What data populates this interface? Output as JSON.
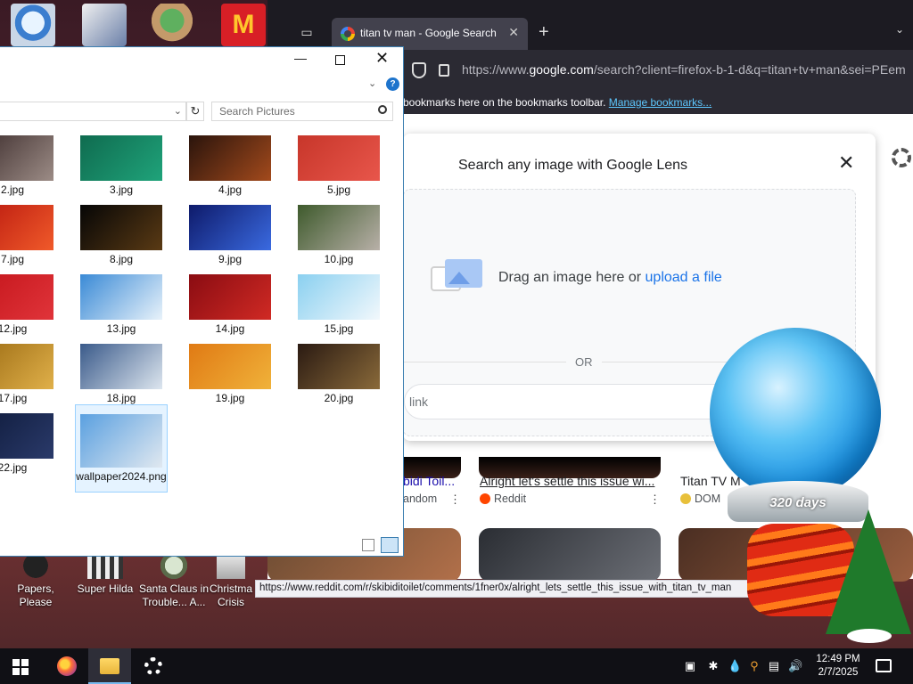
{
  "browser": {
    "tab_title": "titan tv man - Google Search",
    "url_prefix": "https://www.",
    "url_host": "google.com",
    "url_rest": "/search?client=firefox-b-1-d&q=titan+tv+man&sei=PEem",
    "bookmarks_text": "bookmarks here on the bookmarks toolbar. ",
    "bookmarks_link": "Manage bookmarks...",
    "lens": {
      "title": "Search any image with Google Lens",
      "drag_text": "Drag an image here or ",
      "upload_link": "upload a file",
      "or_text": "OR",
      "link_placeholder": "link"
    },
    "results": [
      {
        "title": "bidi Toil...",
        "source": "andom"
      },
      {
        "title": "Alright let's settle this issue wi...",
        "source": "Reddit"
      },
      {
        "title": "Titan TV M",
        "source": "DOM"
      }
    ],
    "status_url": "https://www.reddit.com/r/skibiditoilet/comments/1fner0x/alright_lets_settle_this_issue_with_titan_tv_man"
  },
  "explorer": {
    "search_placeholder": "Search Pictures",
    "files": [
      {
        "name": "2.jpg",
        "colors": [
          "#3a2a2a",
          "#9c8c86"
        ]
      },
      {
        "name": "3.jpg",
        "colors": [
          "#0f6b4f",
          "#1fa37a"
        ]
      },
      {
        "name": "4.jpg",
        "colors": [
          "#2a140c",
          "#a34a1c"
        ]
      },
      {
        "name": "5.jpg",
        "colors": [
          "#c7362a",
          "#e8564b"
        ]
      },
      {
        "name": "7.jpg",
        "colors": [
          "#b7160e",
          "#f05a2a"
        ]
      },
      {
        "name": "8.jpg",
        "colors": [
          "#060606",
          "#5a3a14"
        ]
      },
      {
        "name": "9.jpg",
        "colors": [
          "#0e1a6a",
          "#3a6ae0"
        ]
      },
      {
        "name": "10.jpg",
        "colors": [
          "#3e5a2c",
          "#b8b0a8"
        ]
      },
      {
        "name": "12.jpg",
        "colors": [
          "#c3141a",
          "#e0343a"
        ]
      },
      {
        "name": "13.jpg",
        "colors": [
          "#3a8ad6",
          "#e8f2fa"
        ]
      },
      {
        "name": "14.jpg",
        "colors": [
          "#8a0c12",
          "#d02a24"
        ]
      },
      {
        "name": "15.jpg",
        "colors": [
          "#8ad0f0",
          "#f2f8fc"
        ]
      },
      {
        "name": "17.jpg",
        "colors": [
          "#9a6a12",
          "#e0b04a"
        ]
      },
      {
        "name": "18.jpg",
        "colors": [
          "#3a5a8a",
          "#dde6ef"
        ]
      },
      {
        "name": "19.jpg",
        "colors": [
          "#e07a14",
          "#f0b23a"
        ]
      },
      {
        "name": "20.jpg",
        "colors": [
          "#2a1a12",
          "#8a6a3a"
        ]
      },
      {
        "name": "22.jpg",
        "colors": [
          "#0e1a3a",
          "#2a3a6a"
        ]
      },
      {
        "name": "wallpaper2024.png",
        "colors": [
          "#5aa0e0",
          "#e0e8f0"
        ]
      }
    ]
  },
  "desktop_icons": [
    {
      "label": "Papers, Please"
    },
    {
      "label": "Super Hilda"
    },
    {
      "label": "Santa Claus in Trouble... A..."
    },
    {
      "label": "Christma Crisis"
    }
  ],
  "widget": {
    "days": "320 days"
  },
  "taskbar": {
    "time": "12:49 PM",
    "date": "2/7/2025",
    "apps": [
      "Firefox",
      "File Explorer",
      "Settings"
    ]
  }
}
